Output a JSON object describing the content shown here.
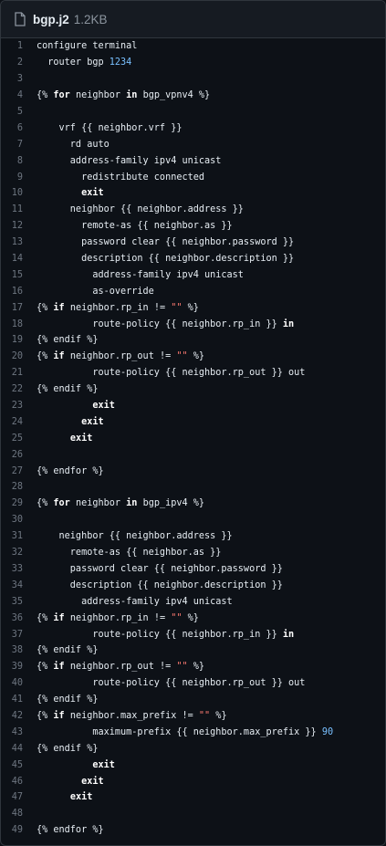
{
  "file": {
    "name": "bgp.j2",
    "size": "1.2KB",
    "icon": "file-icon"
  },
  "lines": [
    [
      {
        "t": "configure terminal",
        "c": ""
      }
    ],
    [
      {
        "t": "  router bgp ",
        "c": ""
      },
      {
        "t": "1234",
        "c": "num"
      }
    ],
    [],
    [
      {
        "t": "{% ",
        "c": ""
      },
      {
        "t": "for",
        "c": "kw"
      },
      {
        "t": " neighbor ",
        "c": ""
      },
      {
        "t": "in",
        "c": "kw"
      },
      {
        "t": " bgp_vpnv4 %}",
        "c": ""
      }
    ],
    [],
    [
      {
        "t": "    vrf {{ neighbor.vrf }}",
        "c": ""
      }
    ],
    [
      {
        "t": "      rd auto",
        "c": ""
      }
    ],
    [
      {
        "t": "      address-family ipv4 unicast",
        "c": ""
      }
    ],
    [
      {
        "t": "        redistribute connected",
        "c": ""
      }
    ],
    [
      {
        "t": "        ",
        "c": ""
      },
      {
        "t": "exit",
        "c": "kw"
      }
    ],
    [
      {
        "t": "      neighbor {{ neighbor.address }}",
        "c": ""
      }
    ],
    [
      {
        "t": "        remote-as {{ neighbor.as }}",
        "c": ""
      }
    ],
    [
      {
        "t": "        password clear {{ neighbor.password }}",
        "c": ""
      }
    ],
    [
      {
        "t": "        description {{ neighbor.description }}",
        "c": ""
      }
    ],
    [
      {
        "t": "          address-family ipv4 unicast",
        "c": ""
      }
    ],
    [
      {
        "t": "          as-override",
        "c": ""
      }
    ],
    [
      {
        "t": "{% ",
        "c": ""
      },
      {
        "t": "if",
        "c": "kw"
      },
      {
        "t": " neighbor.rp_in != ",
        "c": ""
      },
      {
        "t": "\"\"",
        "c": "str"
      },
      {
        "t": " %}",
        "c": ""
      }
    ],
    [
      {
        "t": "          route-policy {{ neighbor.rp_in }} ",
        "c": ""
      },
      {
        "t": "in",
        "c": "kw"
      }
    ],
    [
      {
        "t": "{% endif %}",
        "c": ""
      }
    ],
    [
      {
        "t": "{% ",
        "c": ""
      },
      {
        "t": "if",
        "c": "kw"
      },
      {
        "t": " neighbor.rp_out != ",
        "c": ""
      },
      {
        "t": "\"\"",
        "c": "str"
      },
      {
        "t": " %}",
        "c": ""
      }
    ],
    [
      {
        "t": "          route-policy {{ neighbor.rp_out }} out",
        "c": ""
      }
    ],
    [
      {
        "t": "{% endif %}",
        "c": ""
      }
    ],
    [
      {
        "t": "          ",
        "c": ""
      },
      {
        "t": "exit",
        "c": "kw"
      }
    ],
    [
      {
        "t": "        ",
        "c": ""
      },
      {
        "t": "exit",
        "c": "kw"
      }
    ],
    [
      {
        "t": "      ",
        "c": ""
      },
      {
        "t": "exit",
        "c": "kw"
      }
    ],
    [],
    [
      {
        "t": "{% endfor %}",
        "c": ""
      }
    ],
    [],
    [
      {
        "t": "{% ",
        "c": ""
      },
      {
        "t": "for",
        "c": "kw"
      },
      {
        "t": " neighbor ",
        "c": ""
      },
      {
        "t": "in",
        "c": "kw"
      },
      {
        "t": " bgp_ipv4 %}",
        "c": ""
      }
    ],
    [],
    [
      {
        "t": "    neighbor {{ neighbor.address }}",
        "c": ""
      }
    ],
    [
      {
        "t": "      remote-as {{ neighbor.as }}",
        "c": ""
      }
    ],
    [
      {
        "t": "      password clear {{ neighbor.password }}",
        "c": ""
      }
    ],
    [
      {
        "t": "      description {{ neighbor.description }}",
        "c": ""
      }
    ],
    [
      {
        "t": "        address-family ipv4 unicast",
        "c": ""
      }
    ],
    [
      {
        "t": "{% ",
        "c": ""
      },
      {
        "t": "if",
        "c": "kw"
      },
      {
        "t": " neighbor.rp_in != ",
        "c": ""
      },
      {
        "t": "\"\"",
        "c": "str"
      },
      {
        "t": " %}",
        "c": ""
      }
    ],
    [
      {
        "t": "          route-policy {{ neighbor.rp_in }} ",
        "c": ""
      },
      {
        "t": "in",
        "c": "kw"
      }
    ],
    [
      {
        "t": "{% endif %}",
        "c": ""
      }
    ],
    [
      {
        "t": "{% ",
        "c": ""
      },
      {
        "t": "if",
        "c": "kw"
      },
      {
        "t": " neighbor.rp_out != ",
        "c": ""
      },
      {
        "t": "\"\"",
        "c": "str"
      },
      {
        "t": " %}",
        "c": ""
      }
    ],
    [
      {
        "t": "          route-policy {{ neighbor.rp_out }} out",
        "c": ""
      }
    ],
    [
      {
        "t": "{% endif %}",
        "c": ""
      }
    ],
    [
      {
        "t": "{% ",
        "c": ""
      },
      {
        "t": "if",
        "c": "kw"
      },
      {
        "t": " neighbor.max_prefix != ",
        "c": ""
      },
      {
        "t": "\"\"",
        "c": "str"
      },
      {
        "t": " %}",
        "c": ""
      }
    ],
    [
      {
        "t": "          maximum-prefix {{ neighbor.max_prefix }} ",
        "c": ""
      },
      {
        "t": "90",
        "c": "num"
      }
    ],
    [
      {
        "t": "{% endif %}",
        "c": ""
      }
    ],
    [
      {
        "t": "          ",
        "c": ""
      },
      {
        "t": "exit",
        "c": "kw"
      }
    ],
    [
      {
        "t": "        ",
        "c": ""
      },
      {
        "t": "exit",
        "c": "kw"
      }
    ],
    [
      {
        "t": "      ",
        "c": ""
      },
      {
        "t": "exit",
        "c": "kw"
      }
    ],
    [],
    [
      {
        "t": "{% endfor %}",
        "c": ""
      }
    ]
  ],
  "colors": {
    "background": "#0d1117",
    "header": "#161b22",
    "keyword": "#ffffff",
    "number": "#79c0ff",
    "string": "#ff7b72",
    "line_number": "#6e7681"
  }
}
